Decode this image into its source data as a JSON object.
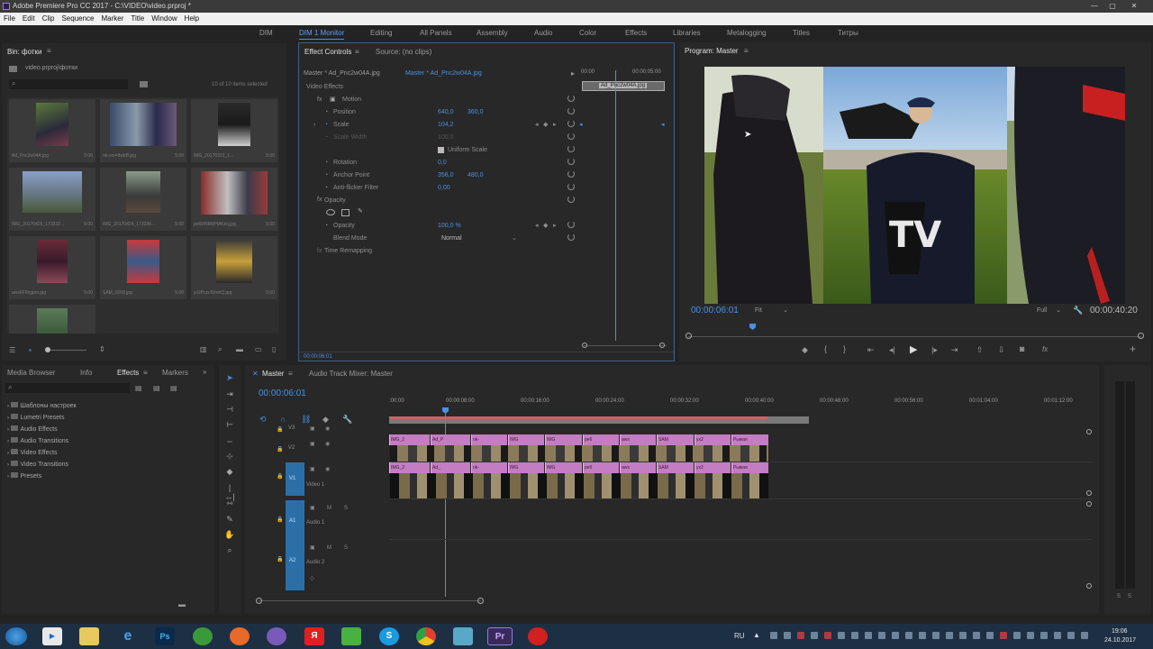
{
  "window": {
    "title": "Adobe Premiere Pro CC 2017 - C:\\VIDEO\\video.prproj *",
    "minimize": "—",
    "maximize": "▢",
    "close": "✕"
  },
  "menu": [
    "File",
    "Edit",
    "Clip",
    "Sequence",
    "Marker",
    "Title",
    "Window",
    "Help"
  ],
  "workspaces": [
    "DIM",
    "DIM 1 Monitor",
    "Editing",
    "All Panels",
    "Assembly",
    "Audio",
    "Color",
    "Effects",
    "Libraries",
    "Metalogging",
    "Titles",
    "Титры"
  ],
  "active_workspace": "DIM 1 Monitor",
  "bin": {
    "tab": "Bin: фотки",
    "path": "video.prproj\\фотки",
    "search_placeholder": "",
    "count": "10 of 10 items selected",
    "items": [
      {
        "name": "Ad_Pnc2w04A.jpg",
        "dur": "5:00"
      },
      {
        "name": "nk-vm=8wbB.jpg",
        "dur": "5:00"
      },
      {
        "name": "IMG_20170322_1...",
        "dur": "5:00"
      },
      {
        "name": "IMG_20170426_173332...",
        "dur": "5:00"
      },
      {
        "name": "IMG_20170424_173336...",
        "dur": "5:00"
      },
      {
        "name": "pe6RNRMHAKkq.jpg",
        "dur": "5:00"
      },
      {
        "name": "aws6F6hgpm.jpg",
        "dur": "5:00"
      },
      {
        "name": "SAM_0268.jpg",
        "dur": "5:00"
      },
      {
        "name": "yx2PccclUmhQ.jpg",
        "dur": "5:00"
      },
      {
        "name": "",
        "dur": ""
      }
    ]
  },
  "effect_controls": {
    "tab": "Effect Controls",
    "tab2": "Source: (no clips)",
    "master_label": "Master * Ad_Pnc2w04A.jpg",
    "clip_label": "Master * Ad_Pnc2w04A.jpg",
    "time_start": "00:00",
    "time_end": "00:00:05:00",
    "clip_name": "Ad_Pnc2w04A.jpg",
    "section": "Video Effects",
    "motion": "Motion",
    "position_label": "Position",
    "position_x": "640,0",
    "position_y": "360,0",
    "scale_label": "Scale",
    "scale_val": "104,2",
    "scale_width_label": "Scale Width",
    "scale_width_val": "100,0",
    "uniform_scale": "Uniform Scale",
    "rotation_label": "Rotation",
    "rotation_val": "0,0",
    "anchor_label": "Anchor Point",
    "anchor_x": "358,0",
    "anchor_y": "480,0",
    "antiflicker_label": "Anti-flicker Filter",
    "antiflicker_val": "0,00",
    "opacity_section": "Opacity",
    "opacity_label": "Opacity",
    "opacity_val": "100,0 %",
    "blend_label": "Blend Mode",
    "blend_val": "Normal",
    "time_remap": "Time Remapping",
    "timecode": "00:00:06:01"
  },
  "program": {
    "tab": "Program: Master",
    "timecode": "00:00:06:01",
    "fit": "Fit",
    "quality": "Full",
    "duration": "00:00:40:20"
  },
  "effects_panel": {
    "tabs": [
      "Media Browser",
      "Info",
      "Effects",
      "Markers"
    ],
    "active_tab": "Effects",
    "items": [
      "Шаблоны настроек",
      "Lumetri Presets",
      "Audio Effects",
      "Audio Transitions",
      "Video Effects",
      "Video Transitions",
      "Presets"
    ]
  },
  "timeline": {
    "tab": "Master",
    "tab2": "Audio Track Mixer: Master",
    "timecode": "00:00:06:01",
    "ruler": [
      ":00:00",
      "00:00:08:00",
      "00:00:16:00",
      "00:00:24:00",
      "00:00:32:00",
      "00:00:40:00",
      "00:00:48:00",
      "00:00:56:00",
      "00:01:04:00",
      "00:01:12:00"
    ],
    "tracks": [
      {
        "id": "V3",
        "name": ""
      },
      {
        "id": "V2",
        "name": ""
      },
      {
        "id": "V1",
        "name": "Video 1"
      },
      {
        "id": "A1",
        "name": "Audio 1"
      },
      {
        "id": "A2",
        "name": "Audio 2"
      }
    ],
    "clips_top": [
      "IMG_2",
      "Ad_P",
      "nk-",
      "IMG",
      "IMG",
      "pe6",
      "aws",
      "SAM",
      "yx2",
      "Рыжая"
    ],
    "clips_bottom": [
      "IMG_2",
      "Ad_",
      "nk-",
      "IMG",
      "IMG",
      "pe6",
      "aws",
      "SAM",
      "yx2",
      "Рыжая"
    ]
  },
  "taskbar": {
    "lang": "RU",
    "time": "19:06",
    "date": "24.10.2017",
    "apps": [
      "windows-start",
      "media",
      "explorer",
      "ie",
      "photoshop",
      "utorrent",
      "ccleaner",
      "viber",
      "yandex",
      "utorrent2",
      "skype",
      "chrome",
      "misc",
      "premiere",
      "record"
    ],
    "app_labels": {
      "ps": "Ps",
      "pr": "Pr",
      "ya": "Я",
      "s": "S",
      "e": "e"
    }
  },
  "colors": {
    "accent": "#4a90e2",
    "clip_pink": "#c47cc2",
    "track_blue": "#2a6fa8",
    "timeline_bar_red": "#c86464"
  }
}
